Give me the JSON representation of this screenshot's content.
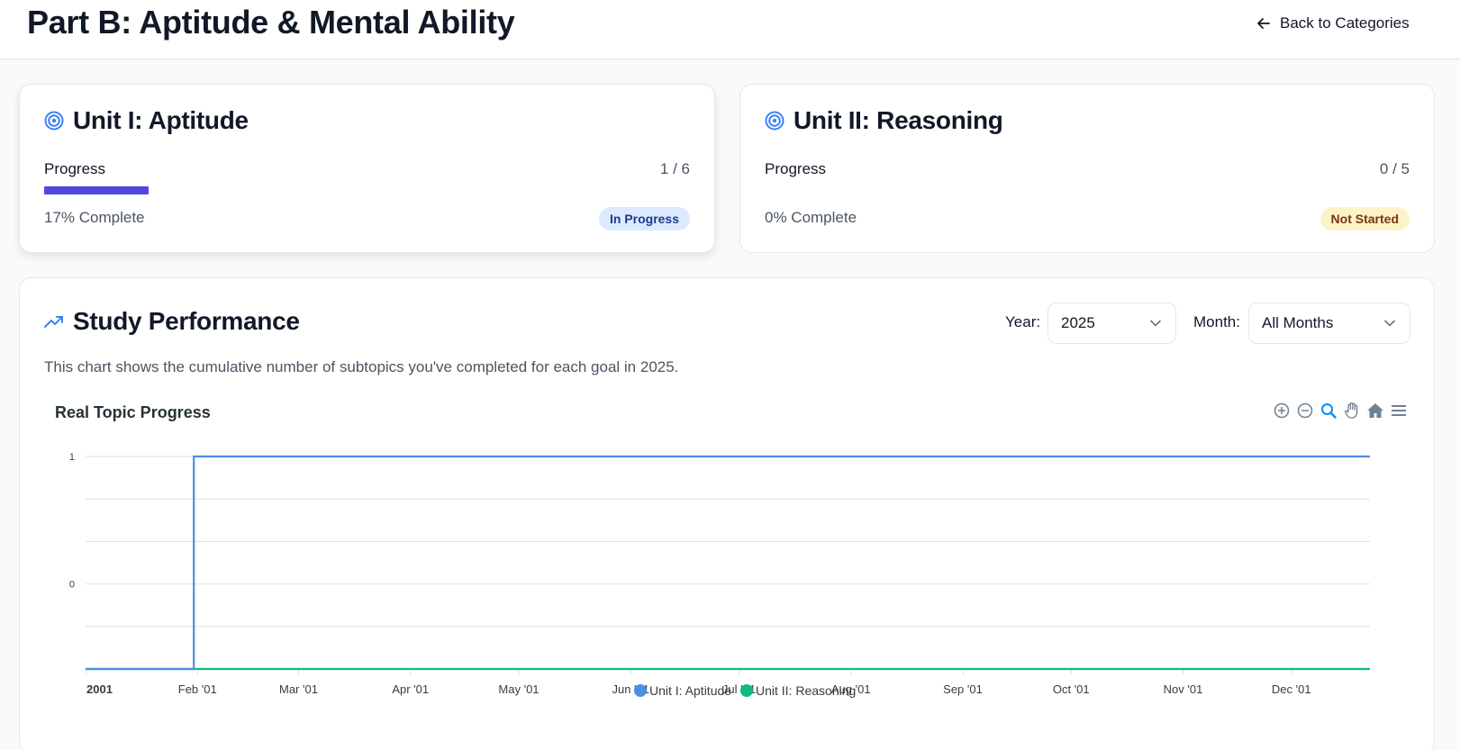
{
  "header": {
    "title": "Part B: Aptitude & Mental Ability",
    "back_label": "Back to Categories"
  },
  "units": [
    {
      "title": "Unit I: Aptitude",
      "progress_label": "Progress",
      "count": "1 / 6",
      "fraction": 0.17,
      "complete_text": "17% Complete",
      "status": "In Progress"
    },
    {
      "title": "Unit II: Reasoning",
      "progress_label": "Progress",
      "count": "0 / 5",
      "fraction": 0,
      "complete_text": "0% Complete",
      "status": "Not Started"
    }
  ],
  "performance": {
    "title": "Study Performance",
    "year_label": "Year:",
    "year_value": "2025",
    "month_label": "Month:",
    "month_value": "All Months",
    "description": "This chart shows the cumulative number of subtopics you've completed for each goal in 2025."
  },
  "toolbar_icons": [
    "zoom-in-icon",
    "zoom-out-icon",
    "selection-zoom-icon",
    "pan-hand-icon",
    "home-reset-icon",
    "menu-icon"
  ],
  "colors": {
    "accent": "#4f46e5",
    "series_unit1": "#4a90e2",
    "series_unit2": "#10b981",
    "badge_in_progress_bg": "#dbeafe",
    "badge_not_started_bg": "#fef3c7"
  },
  "chart_data": {
    "type": "line",
    "title": "Real Topic Progress",
    "x_ticks": [
      "2001",
      "Feb '01",
      "Mar '01",
      "Apr '01",
      "May '01",
      "Jun '01",
      "Jul '01",
      "Aug '01",
      "Sep '01",
      "Oct '01",
      "Nov '01",
      "Dec '01"
    ],
    "x_range": [
      "2001-01-01",
      "2001-12-31"
    ],
    "y_ticks": [
      "1",
      "0"
    ],
    "ylim": [
      -0.666,
      1
    ],
    "grid": true,
    "legend_position": "bottom",
    "series": [
      {
        "name": "Unit I: Aptitude",
        "step": true,
        "points": [
          {
            "x": "2001-01-01",
            "y": -0.666
          },
          {
            "x": "2001-01-31",
            "y": -0.666
          },
          {
            "x": "2001-01-31",
            "y": 1
          },
          {
            "x": "2001-12-31",
            "y": 1
          }
        ]
      },
      {
        "name": "Unit II: Reasoning",
        "step": true,
        "points": [
          {
            "x": "2001-01-01",
            "y": -0.666
          },
          {
            "x": "2001-12-31",
            "y": -0.666
          }
        ]
      }
    ]
  }
}
